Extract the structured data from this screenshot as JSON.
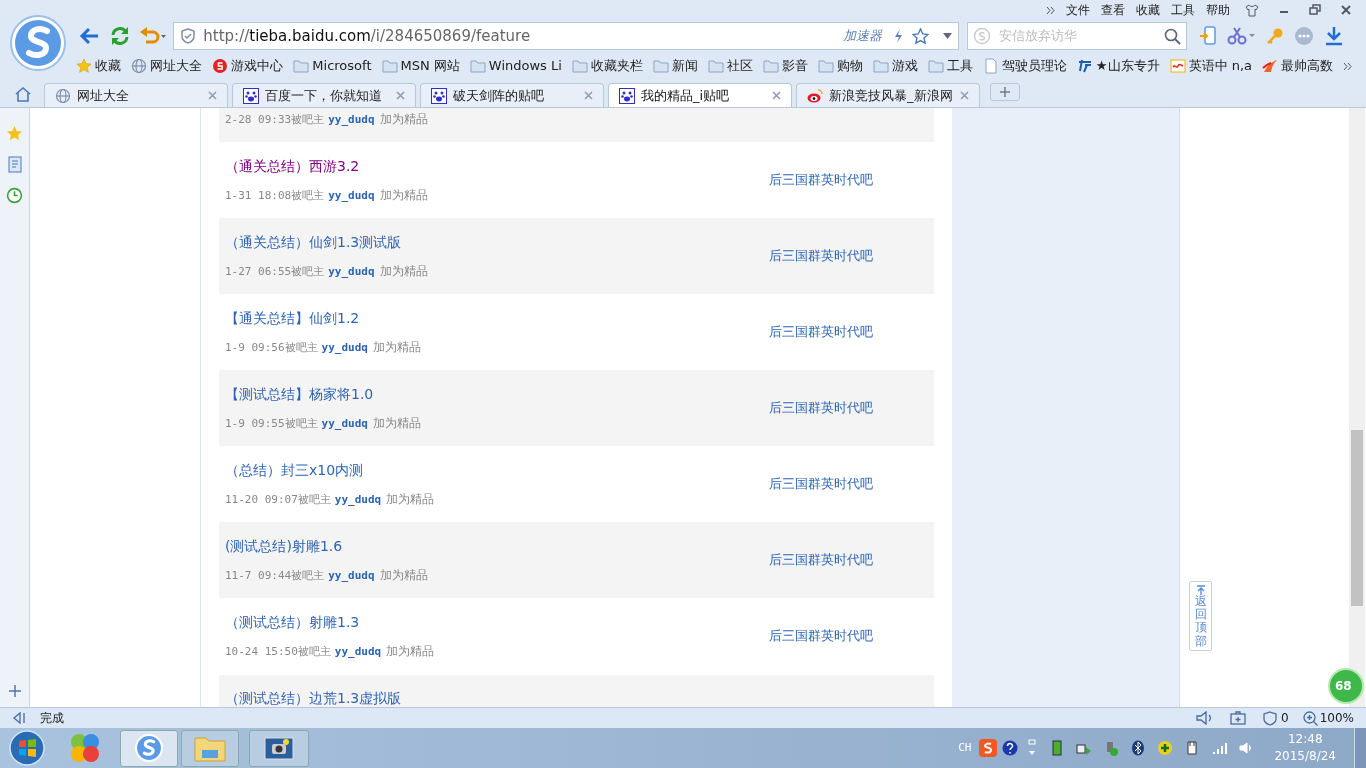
{
  "menu": {
    "items": [
      "文件",
      "查看",
      "收藏",
      "工具",
      "帮助"
    ]
  },
  "address": {
    "url": "http://**tieba.baidu.com**/i/284650869/feature",
    "accelerator": "加速器"
  },
  "search": {
    "placeholder": "安信放弃访华"
  },
  "bookmarks": [
    {
      "kind": "star",
      "label": "收藏"
    },
    {
      "kind": "globe",
      "label": "网址大全"
    },
    {
      "kind": "game",
      "label": "游戏中心"
    },
    {
      "kind": "folder",
      "label": "Microsoft"
    },
    {
      "kind": "folder",
      "label": "MSN 网站"
    },
    {
      "kind": "folder",
      "label": "Windows Li"
    },
    {
      "kind": "folder",
      "label": "收藏夹栏"
    },
    {
      "kind": "folder",
      "label": "新闻"
    },
    {
      "kind": "folder",
      "label": "社区"
    },
    {
      "kind": "folder",
      "label": "影音"
    },
    {
      "kind": "folder",
      "label": "购物"
    },
    {
      "kind": "folder",
      "label": "游戏"
    },
    {
      "kind": "folder",
      "label": "工具"
    },
    {
      "kind": "doc",
      "label": "驾驶员理论"
    },
    {
      "kind": "exam",
      "label": "★山东专升"
    },
    {
      "kind": "score",
      "label": "英语中 n,a"
    },
    {
      "kind": "flame",
      "label": "最帅高数"
    }
  ],
  "tabs": [
    {
      "kind": "globe",
      "label": "网址大全",
      "selected": false
    },
    {
      "kind": "paw",
      "label": "百度一下，你就知道",
      "selected": false
    },
    {
      "kind": "paw",
      "label": "破天剑阵的贴吧",
      "selected": false
    },
    {
      "kind": "paw",
      "label": "我的精品_i贴吧",
      "selected": true
    },
    {
      "kind": "weibo",
      "label": "新浪竞技风暴_新浪网",
      "selected": false
    }
  ],
  "posts": [
    {
      "kind": "meta_only",
      "time": "2-28 09:33被吧主",
      "author": "yy_dudq",
      "action": "加为精品"
    },
    {
      "kind": "full",
      "title": "（通关总结）西游3.2",
      "visited": true,
      "time": "1-31 18:08被吧主",
      "author": "yy_dudq",
      "action": "加为精品",
      "forum": "后三国群英时代吧"
    },
    {
      "kind": "full",
      "title": "（通关总结）仙剑1.3测试版",
      "visited": false,
      "time": "1-27 06:55被吧主",
      "author": "yy_dudq",
      "action": "加为精品",
      "forum": "后三国群英时代吧"
    },
    {
      "kind": "full",
      "title": "【通关总结】仙剑1.2",
      "visited": false,
      "time": "1-9 09:56被吧主",
      "author": "yy_dudq",
      "action": "加为精品",
      "forum": "后三国群英时代吧"
    },
    {
      "kind": "full",
      "title": "【测试总结】杨家将1.0",
      "visited": false,
      "time": "1-9 09:55被吧主",
      "author": "yy_dudq",
      "action": "加为精品",
      "forum": "后三国群英时代吧"
    },
    {
      "kind": "full",
      "title": "（总结）封三x10内测",
      "visited": false,
      "time": "11-20 09:07被吧主",
      "author": "yy_dudq",
      "action": "加为精品",
      "forum": "后三国群英时代吧"
    },
    {
      "kind": "full",
      "title": "(测试总结)射雕1.6",
      "visited": false,
      "time": "11-7 09:44被吧主",
      "author": "yy_dudq",
      "action": "加为精品",
      "forum": "后三国群英时代吧"
    },
    {
      "kind": "full",
      "title": "（测试总结）射雕1.3",
      "visited": false,
      "time": "10-24 15:50被吧主",
      "author": "yy_dudq",
      "action": "加为精品",
      "forum": "后三国群英时代吧"
    },
    {
      "kind": "title_only",
      "title": "（测试总结）边荒1.3虚拟版",
      "visited": false
    }
  ],
  "back_to_top": {
    "label": "返回顶部"
  },
  "badge": {
    "label": "68"
  },
  "status_bar": {
    "text": "完成",
    "ad_count": "0",
    "zoom": "100%"
  },
  "taskbar": {
    "tray_lang": "CH",
    "time": "12:48",
    "date": "2015/8/24"
  }
}
